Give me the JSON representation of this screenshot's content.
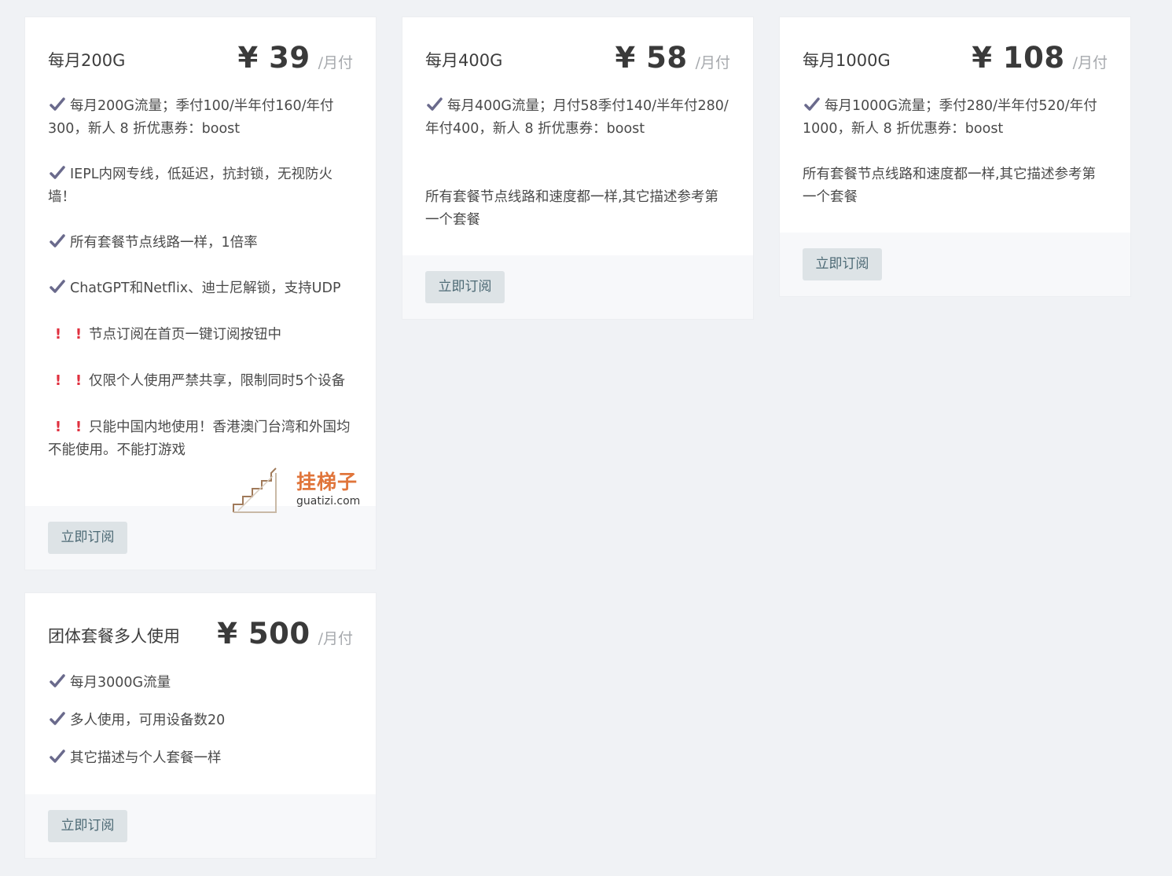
{
  "colors": {
    "page_bg": "#f0f2f5",
    "card_bg": "#ffffff",
    "footer_bg": "#f7f8fa",
    "check": "#6a6a8c",
    "alert": "#e0303f",
    "button_bg": "#dde3e6",
    "button_text": "#4d6a75",
    "watermark": "#e0753b"
  },
  "plans": [
    {
      "name": "每月200G",
      "price": "¥ 39",
      "period": "/月付",
      "button": "立即订阅",
      "lines": [
        {
          "icon": "check-icon",
          "text": "每月200G流量；季付100/半年付160/年付300，新人 8 折优惠券：boost"
        },
        {
          "icon": "check-icon",
          "text": "IEPL内网专线，低延迟，抗封锁，无视防火墙！"
        },
        {
          "icon": "check-icon",
          "text": "所有套餐节点线路一样，1倍率"
        },
        {
          "icon": "check-icon",
          "text": "ChatGPT和Netflix、迪士尼解锁，支持UDP"
        },
        {
          "icon": "alert-icon",
          "text": "节点订阅在首页一键订阅按钮中"
        },
        {
          "icon": "alert-icon",
          "text": "仅限个人使用严禁共享，限制同时5个设备"
        },
        {
          "icon": "alert-icon",
          "text": "只能中国内地使用！香港澳门台湾和外国均不能使用。不能打游戏"
        }
      ]
    },
    {
      "name": "每月400G",
      "price": "¥ 58",
      "period": "/月付",
      "button": "立即订阅",
      "lines": [
        {
          "icon": "check-icon",
          "text": "每月400G流量；月付58季付140/半年付280/年付400，新人 8 折优惠券：boost"
        },
        {
          "icon": "none",
          "text": "所有套餐节点线路和速度都一样,其它描述参考第一个套餐"
        }
      ]
    },
    {
      "name": "每月1000G",
      "price": "¥ 108",
      "period": "/月付",
      "button": "立即订阅",
      "lines": [
        {
          "icon": "check-icon",
          "text": "每月1000G流量；季付280/半年付520/年付1000，新人 8 折优惠券：boost"
        },
        {
          "icon": "none",
          "text": "所有套餐节点线路和速度都一样,其它描述参考第一个套餐"
        }
      ]
    },
    {
      "name": "团体套餐多人使用",
      "price": "¥ 500",
      "period": "/月付",
      "button": "立即订阅",
      "lines": [
        {
          "icon": "check-icon",
          "text": "每月3000G流量"
        },
        {
          "icon": "check-icon",
          "text": "多人使用，可用设备数20"
        },
        {
          "icon": "check-icon",
          "text": "其它描述与个人套餐一样"
        }
      ]
    }
  ],
  "watermark": {
    "title": "挂梯子",
    "domain": "guatizi.com"
  }
}
